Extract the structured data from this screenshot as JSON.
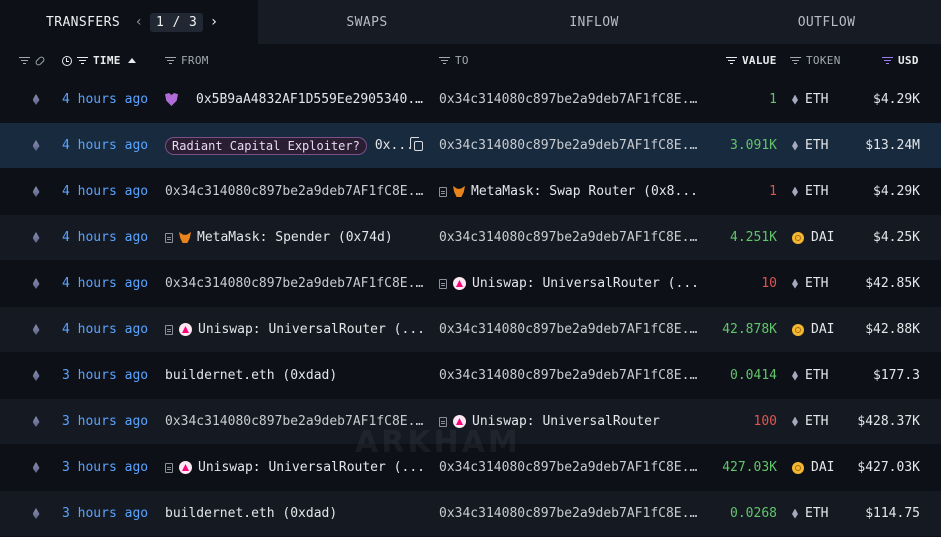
{
  "tabs": [
    {
      "label": "TRANSFERS",
      "active": true
    },
    {
      "label": "SWAPS",
      "active": false
    },
    {
      "label": "INFLOW",
      "active": false
    },
    {
      "label": "OUTFLOW",
      "active": false
    }
  ],
  "pagination": {
    "current": "1",
    "separator": "/",
    "total": "3"
  },
  "columns": {
    "time": "TIME",
    "from": "FROM",
    "to": "TO",
    "value": "VALUE",
    "token": "TOKEN",
    "usd": "USD"
  },
  "sort": {
    "column": "TIME",
    "direction": "ascending"
  },
  "colors": {
    "link_blue": "#5aa3ff",
    "positive": "#62c46b",
    "negative": "#e0544f",
    "accent_purple": "#9b7ff0"
  },
  "watermark": "ARKHAM",
  "rows": [
    {
      "chain_icon": "eth-icon",
      "time": "4 hours ago",
      "from": {
        "icon": "shield-icon",
        "text": "0x5B9aA4832AF1D559Ee2905340..."
      },
      "to": {
        "text": "0x34c314080c897be2a9deb7AF1fC8E..."
      },
      "value": "1",
      "value_color": "positive",
      "token": "ETH",
      "token_icon": "eth-icon",
      "usd": "$4.29K"
    },
    {
      "chain_icon": "eth-icon",
      "time": "4 hours ago",
      "from": {
        "label": "Radiant Capital Exploiter?",
        "text": "0x...",
        "copy_icon": true
      },
      "to": {
        "text": "0x34c314080c897be2a9deb7AF1fC8E..."
      },
      "value": "3.091K",
      "value_color": "positive",
      "token": "ETH",
      "token_icon": "eth-icon",
      "usd": "$13.24M",
      "highlight": true
    },
    {
      "chain_icon": "eth-icon",
      "time": "4 hours ago",
      "from": {
        "text": "0x34c314080c897be2a9deb7AF1fC8E..."
      },
      "to": {
        "icon": "metamask-icon",
        "text": "MetaMask: Swap Router (0x8..."
      },
      "value": "1",
      "value_color": "negative",
      "token": "ETH",
      "token_icon": "eth-icon",
      "usd": "$4.29K"
    },
    {
      "chain_icon": "eth-icon",
      "time": "4 hours ago",
      "from": {
        "icon": "metamask-icon",
        "text": "MetaMask: Spender (0x74d)"
      },
      "to": {
        "text": "0x34c314080c897be2a9deb7AF1fC8E..."
      },
      "value": "4.251K",
      "value_color": "positive",
      "token": "DAI",
      "token_icon": "dai-icon",
      "usd": "$4.25K"
    },
    {
      "chain_icon": "eth-icon",
      "time": "4 hours ago",
      "from": {
        "text": "0x34c314080c897be2a9deb7AF1fC8E..."
      },
      "to": {
        "icon": "uniswap-icon",
        "text": "Uniswap: UniversalRouter (..."
      },
      "value": "10",
      "value_color": "negative",
      "token": "ETH",
      "token_icon": "eth-icon",
      "usd": "$42.85K"
    },
    {
      "chain_icon": "eth-icon",
      "time": "4 hours ago",
      "from": {
        "icon": "uniswap-icon",
        "text": "Uniswap: UniversalRouter (..."
      },
      "to": {
        "text": "0x34c314080c897be2a9deb7AF1fC8E..."
      },
      "value": "42.878K",
      "value_color": "positive",
      "token": "DAI",
      "token_icon": "dai-icon",
      "usd": "$42.88K"
    },
    {
      "chain_icon": "eth-icon",
      "time": "3 hours ago",
      "from": {
        "text": "buildernet.eth (0xdad)"
      },
      "to": {
        "text": "0x34c314080c897be2a9deb7AF1fC8E..."
      },
      "value": "0.0414",
      "value_color": "positive",
      "token": "ETH",
      "token_icon": "eth-icon",
      "usd": "$177.3"
    },
    {
      "chain_icon": "eth-icon",
      "time": "3 hours ago",
      "from": {
        "text": "0x34c314080c897be2a9deb7AF1fC8E..."
      },
      "to": {
        "icon": "uniswap-icon",
        "text": "Uniswap: UniversalRouter"
      },
      "value": "100",
      "value_color": "negative",
      "token": "ETH",
      "token_icon": "eth-icon",
      "usd": "$428.37K"
    },
    {
      "chain_icon": "eth-icon",
      "time": "3 hours ago",
      "from": {
        "icon": "uniswap-icon",
        "text": "Uniswap: UniversalRouter (..."
      },
      "to": {
        "text": "0x34c314080c897be2a9deb7AF1fC8E..."
      },
      "value": "427.03K",
      "value_color": "positive",
      "token": "DAI",
      "token_icon": "dai-icon",
      "usd": "$427.03K"
    },
    {
      "chain_icon": "eth-icon",
      "time": "3 hours ago",
      "from": {
        "text": "buildernet.eth (0xdad)"
      },
      "to": {
        "text": "0x34c314080c897be2a9deb7AF1fC8E..."
      },
      "value": "0.0268",
      "value_color": "positive",
      "token": "ETH",
      "token_icon": "eth-icon",
      "usd": "$114.75"
    }
  ]
}
